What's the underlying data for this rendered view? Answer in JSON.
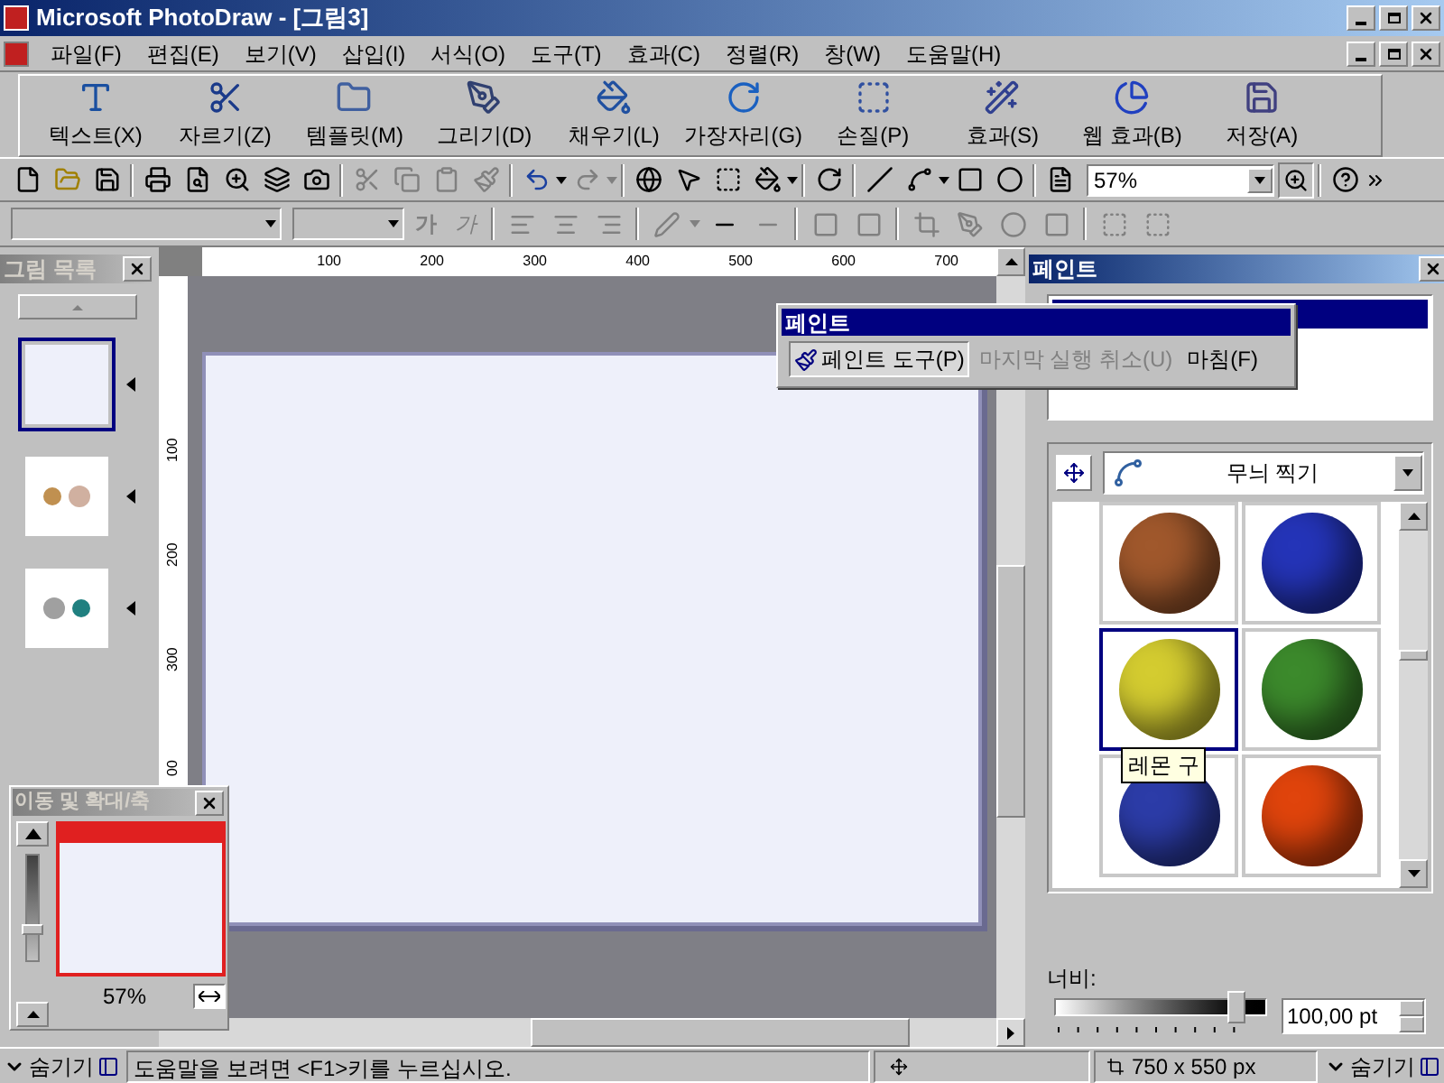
{
  "window": {
    "title": "Microsoft PhotoDraw - [그림3]"
  },
  "menu": [
    "파일(F)",
    "편집(E)",
    "보기(V)",
    "삽입(I)",
    "서식(O)",
    "도구(T)",
    "효과(C)",
    "정렬(R)",
    "창(W)",
    "도움말(H)"
  ],
  "visual_menu": [
    {
      "label": "텍스트(X)",
      "kind": "text"
    },
    {
      "label": "자르기(Z)",
      "kind": "cut"
    },
    {
      "label": "템플릿(M)",
      "kind": "template"
    },
    {
      "label": "그리기(D)",
      "kind": "draw"
    },
    {
      "label": "채우기(L)",
      "kind": "fill"
    },
    {
      "label": "가장자리(G)",
      "kind": "edge"
    },
    {
      "label": "손질(P)",
      "kind": "touchup"
    },
    {
      "label": "효과(S)",
      "kind": "effects"
    },
    {
      "label": "웹 효과(B)",
      "kind": "web"
    },
    {
      "label": "저장(A)",
      "kind": "save"
    }
  ],
  "standard_toolbar": {
    "zoom": "57%"
  },
  "format_toolbar": {
    "bold": "가",
    "italic": "가"
  },
  "picture_list": {
    "title": "그림 목록",
    "items": [
      {
        "selected": true
      },
      {
        "selected": false
      },
      {
        "selected": false
      }
    ]
  },
  "ruler": {
    "horizontal": [
      "100",
      "200",
      "300",
      "400",
      "500",
      "600",
      "700"
    ],
    "vertical": [
      "100",
      "200",
      "300",
      "00"
    ]
  },
  "navigator": {
    "title": "이동 및 확대/축",
    "zoom": "57%",
    "level": 0.3
  },
  "paint_toolbar": {
    "title": "페인트",
    "buttons": [
      {
        "label": "페인트 도구(P)",
        "selected": true,
        "disabled": false
      },
      {
        "label": "마지막 실행 취소(U)",
        "selected": false,
        "disabled": true
      },
      {
        "label": "마침(F)",
        "selected": false,
        "disabled": false
      }
    ]
  },
  "paint_panel": {
    "title": "페인트",
    "gallery": "무늬 찍기",
    "tooltip": "레몬 구",
    "balls": [
      {
        "color": "#a0582c",
        "selected": false
      },
      {
        "color": "#2434b8",
        "selected": false
      },
      {
        "color": "#d4cc30",
        "selected": true
      },
      {
        "color": "#3c8a2c",
        "selected": false
      },
      {
        "color": "#2c3ca8",
        "selected": false
      },
      {
        "color": "#e0440c",
        "selected": false
      }
    ],
    "width_label": "너비:",
    "width": {
      "level": 0.86,
      "value": "100,00 pt"
    }
  },
  "status_bar": {
    "hide_left": "숨기기",
    "help": "도움말을 보려면 <F1>키를 누르십시오.",
    "size": "750 x 550 px",
    "hide_right": "숨기기"
  }
}
